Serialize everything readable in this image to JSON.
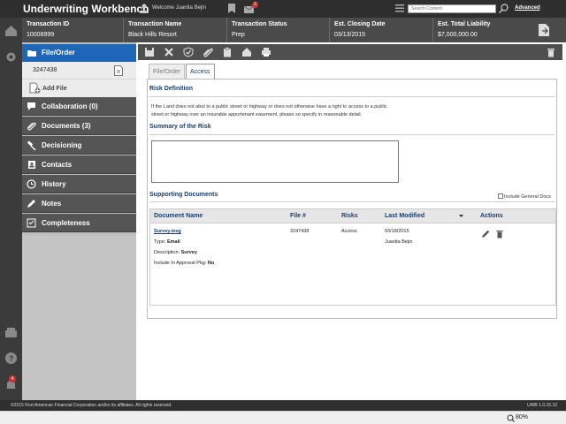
{
  "app": {
    "title": "Underwriting Workbench",
    "welcome": "Welcome Juanita Bejin",
    "mail_count": "2",
    "search_placeholder": "Search Content",
    "advanced_label": "Advanced"
  },
  "transaction": {
    "id_label": "Transaction ID",
    "id_value": "10008999",
    "name_label": "Transaction Name",
    "name_value": "Black Hills Resort",
    "status_label": "Transaction Status",
    "status_value": "Prep",
    "closing_label": "Est. Closing Date",
    "closing_value": "03/13/2015",
    "liability_label": "Est. Total Liability",
    "liability_value": "$7,000,000.00"
  },
  "rail": {
    "alert_count": "4"
  },
  "nav": {
    "active_label": "File/Order",
    "file_number": "3247438",
    "add_file_label": "Add File",
    "items": [
      {
        "label": "Collaboration (0)",
        "icon": "chat-icon"
      },
      {
        "label": "Documents (3)",
        "icon": "paperclip-icon"
      },
      {
        "label": "Decisioning",
        "icon": "gavel-icon"
      },
      {
        "label": "Contacts",
        "icon": "address-book-icon"
      },
      {
        "label": "History",
        "icon": "clock-icon"
      },
      {
        "label": "Notes",
        "icon": "pencil-icon"
      },
      {
        "label": "Completeness",
        "icon": "checklist-icon"
      }
    ]
  },
  "tabs": [
    {
      "label": "File/Order",
      "active": false
    },
    {
      "label": "Access",
      "active": true
    }
  ],
  "risk": {
    "definition_title": "Risk Definition",
    "definition_text_1": "If the Land does not abut to a public street or highway or does not otherwise have a right to access to a public",
    "definition_text_2": "street or highway over an insurable appurtenant easement, please so specify in reasonable detail.",
    "summary_title": "Summary of the Risk",
    "summary_value": ""
  },
  "supporting": {
    "title": "Supporting Documents",
    "include_general_label": "Include General Docs",
    "columns": [
      "Document Name",
      "File #",
      "Risks",
      "Last Modified",
      "Actions"
    ],
    "rows": [
      {
        "name": "Survey.msg",
        "type_label": "Type:",
        "type_value": "Email",
        "desc_label": "Description:",
        "desc_value": "Survey",
        "approval_label": "Include In Approval Pkg:",
        "approval_value": "No",
        "file_no": "3247438",
        "risks": "Access",
        "modified_date": "03/18/2015",
        "modified_by": "Juanita Bejin"
      }
    ]
  },
  "footer": {
    "copyright": "©2015 First American Financial Corporation and/or its affiliates. All rights reserved.",
    "version": "UWB 1.0.15.10"
  },
  "status": {
    "zoom": "80%"
  },
  "colors": {
    "accent": "#1e66b8",
    "header_bg": "#4a4a4a",
    "nav_dark": "#555555",
    "badge_red": "#d0312d"
  }
}
